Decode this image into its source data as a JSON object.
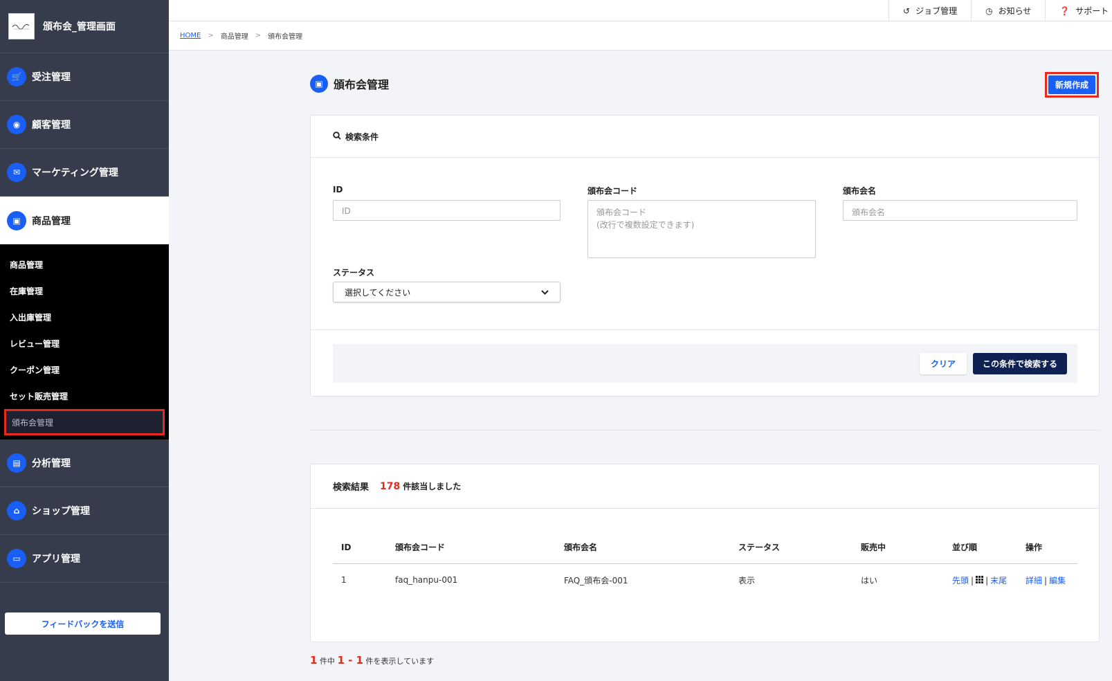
{
  "brand": {
    "title": "頒布会_管理画面",
    "logo_text": "[logo]"
  },
  "sidebar": {
    "items": [
      {
        "label": "受注管理",
        "icon": "cart-icon"
      },
      {
        "label": "顧客管理",
        "icon": "user-icon"
      },
      {
        "label": "マーケティング管理",
        "icon": "mail-icon"
      },
      {
        "label": "商品管理",
        "icon": "box-icon"
      }
    ],
    "sub_items": [
      "商品管理",
      "在庫管理",
      "入出庫管理",
      "レビュー管理",
      "クーポン管理",
      "セット販売管理",
      "頒布会管理"
    ],
    "bottom_items": [
      {
        "label": "分析管理",
        "icon": "chart-icon"
      },
      {
        "label": "ショップ管理",
        "icon": "shop-icon"
      },
      {
        "label": "アプリ管理",
        "icon": "app-icon"
      }
    ],
    "feedback": "フィードバックを送信"
  },
  "topbar": {
    "job": "ジョブ管理",
    "notice": "お知らせ",
    "support": "サポート"
  },
  "breadcrumb": {
    "home": "HOME",
    "sep": ">",
    "level1": "商品管理",
    "level2": "頒布会管理"
  },
  "page": {
    "title": "頒布会管理",
    "new_button": "新規作成"
  },
  "search": {
    "title": "検索条件",
    "id_label": "ID",
    "id_placeholder": "ID",
    "code_label": "頒布会コード",
    "code_placeholder_1": "頒布会コード",
    "code_placeholder_2": "(改行で複数設定できます)",
    "name_label": "頒布会名",
    "name_placeholder": "頒布会名",
    "status_label": "ステータス",
    "status_value": "選択してください",
    "clear_button": "クリア",
    "search_button": "この条件で検索する"
  },
  "results": {
    "title": "検索結果",
    "count": "178",
    "count_suffix": "件該当しました",
    "columns": [
      "ID",
      "頒布会コード",
      "頒布会名",
      "ステータス",
      "販売中",
      "並び順",
      "操作"
    ],
    "rows": [
      {
        "id": "1",
        "code": "faq_hanpu-001",
        "name": "FAQ_頒布会-001",
        "status": "表示",
        "on_sale": "はい",
        "top": "先頭",
        "bottom": "末尾",
        "detail": "詳細",
        "edit": "編集"
      }
    ]
  },
  "footer": {
    "total": "1",
    "text1": "件中",
    "range": "1 - 1",
    "text2": "件を表示しています"
  },
  "colors": {
    "primary": "#1a5ff5",
    "sidebar": "#363c4c",
    "highlight": "#e8291c",
    "navy": "#0f2052"
  }
}
